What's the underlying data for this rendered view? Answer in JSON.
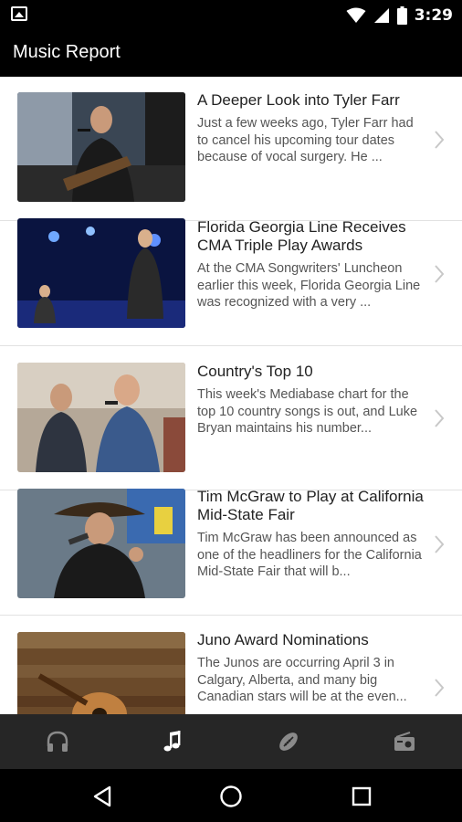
{
  "status_bar": {
    "time": "3:29",
    "icons": [
      "image-notification-icon",
      "wifi-icon",
      "cell-signal-icon",
      "battery-icon"
    ]
  },
  "app_bar": {
    "title": "Music Report"
  },
  "articles": [
    {
      "title": "A Deeper Look into Tyler Farr",
      "description": "Just a few weeks ago, Tyler Farr had to cancel his upcoming tour dates because of vocal surgery. He ..."
    },
    {
      "title": "Florida Georgia Line Receives CMA Triple Play Awards",
      "description": "At the CMA Songwriters' Luncheon earlier this week, Florida Georgia Line was recognized with a very ..."
    },
    {
      "title": "Country's Top 10",
      "description": "This week's Mediabase chart for the top 10 country songs is out, and Luke Bryan maintains his number..."
    },
    {
      "title": "Tim McGraw to Play at California Mid-State Fair",
      "description": "Tim McGraw has been announced as one of the headliners for the California Mid-State Fair that will b..."
    },
    {
      "title": "Juno Award Nominations",
      "description": "The Junos are occurring April 3 in Calgary, Alberta, and many big Canadian stars will be at the even..."
    }
  ],
  "bottom_nav": {
    "items": [
      "headphones-icon",
      "music-note-icon",
      "football-icon",
      "radio-icon"
    ],
    "active": "music-note-icon"
  },
  "system_nav": {
    "items": [
      "back-icon",
      "home-icon",
      "recents-icon"
    ]
  },
  "colors": {
    "bar": "#000000",
    "bottom_nav": "#262626",
    "active_icon": "#ffffff",
    "inactive_icon": "#8a8a8a"
  }
}
